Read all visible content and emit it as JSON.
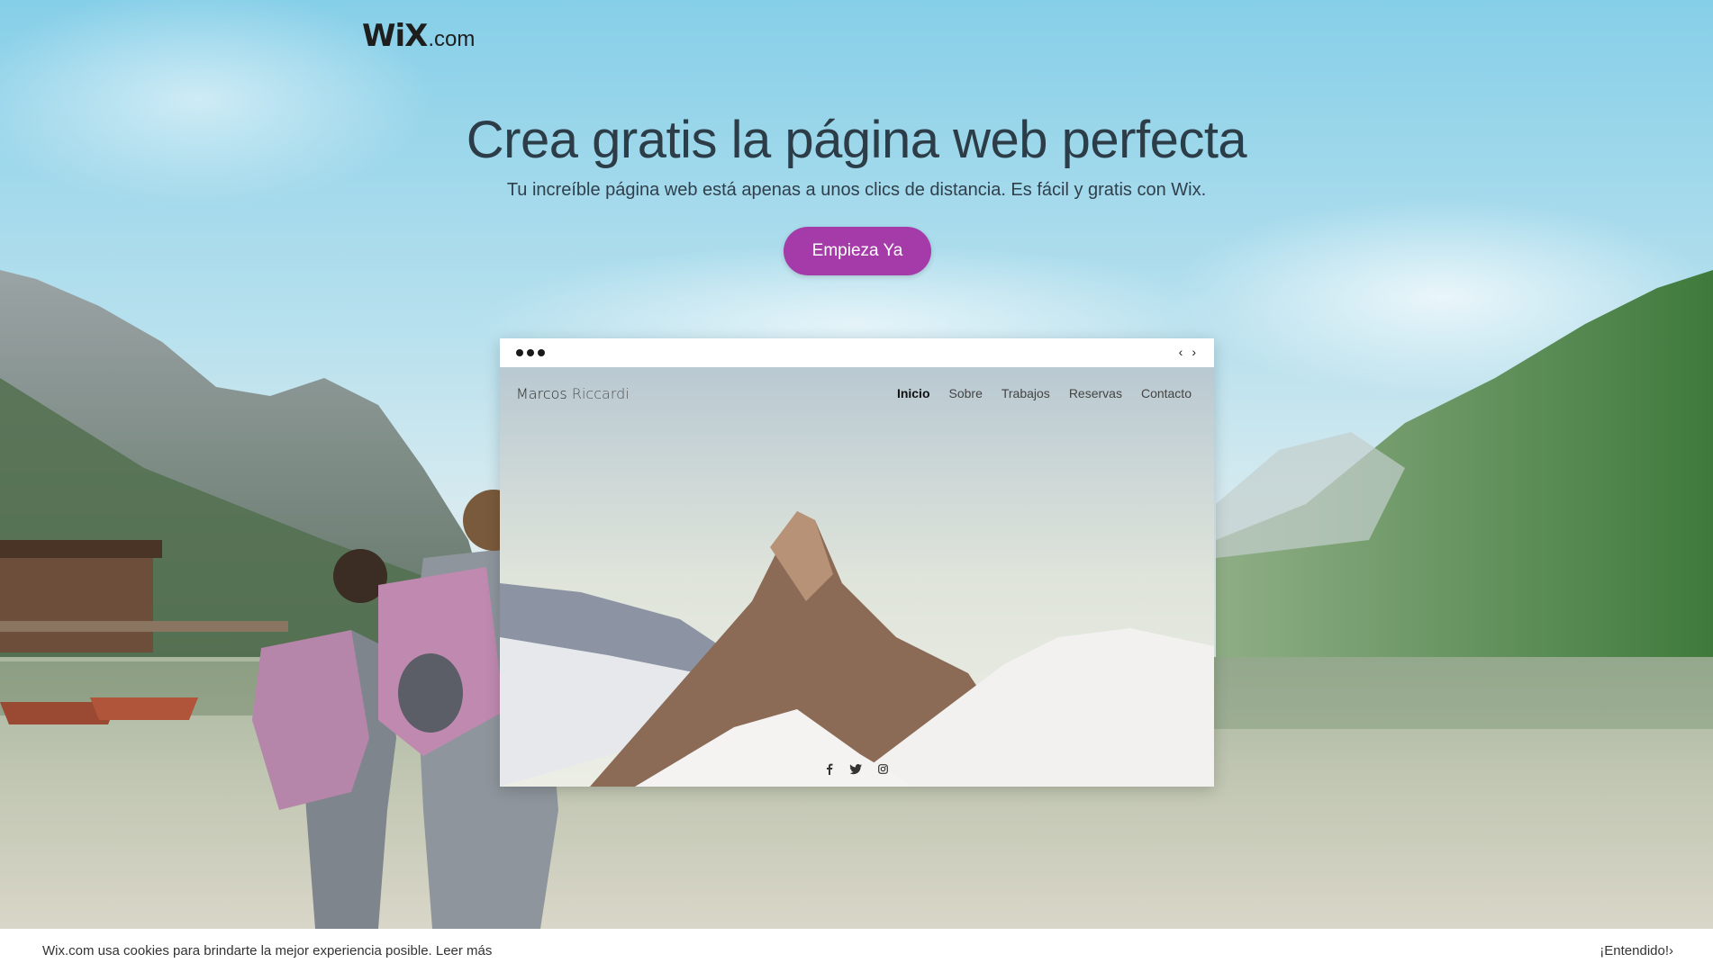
{
  "brand": {
    "logo_main": "WiX",
    "logo_suffix": ".com"
  },
  "hero": {
    "headline": "Crea gratis la página web perfecta",
    "subline": "Tu increíble página web está apenas a unos clics de distancia. Es fácil y gratis con Wix.",
    "cta_label": "Empieza Ya",
    "cta_color": "#a53ba8"
  },
  "preview": {
    "nav_prev": "‹",
    "nav_next": "›",
    "site_title_first": "Marcos",
    "site_title_last": "Riccardi",
    "menu": [
      "Inicio",
      "Sobre",
      "Trabajos",
      "Reservas",
      "Contacto"
    ],
    "social_icons": [
      "facebook-icon",
      "twitter-icon",
      "instagram-icon"
    ]
  },
  "cookie": {
    "message": "Wix.com usa cookies para brindarte la mejor experiencia posible. Leer más",
    "accept": "¡Entendido!›"
  }
}
